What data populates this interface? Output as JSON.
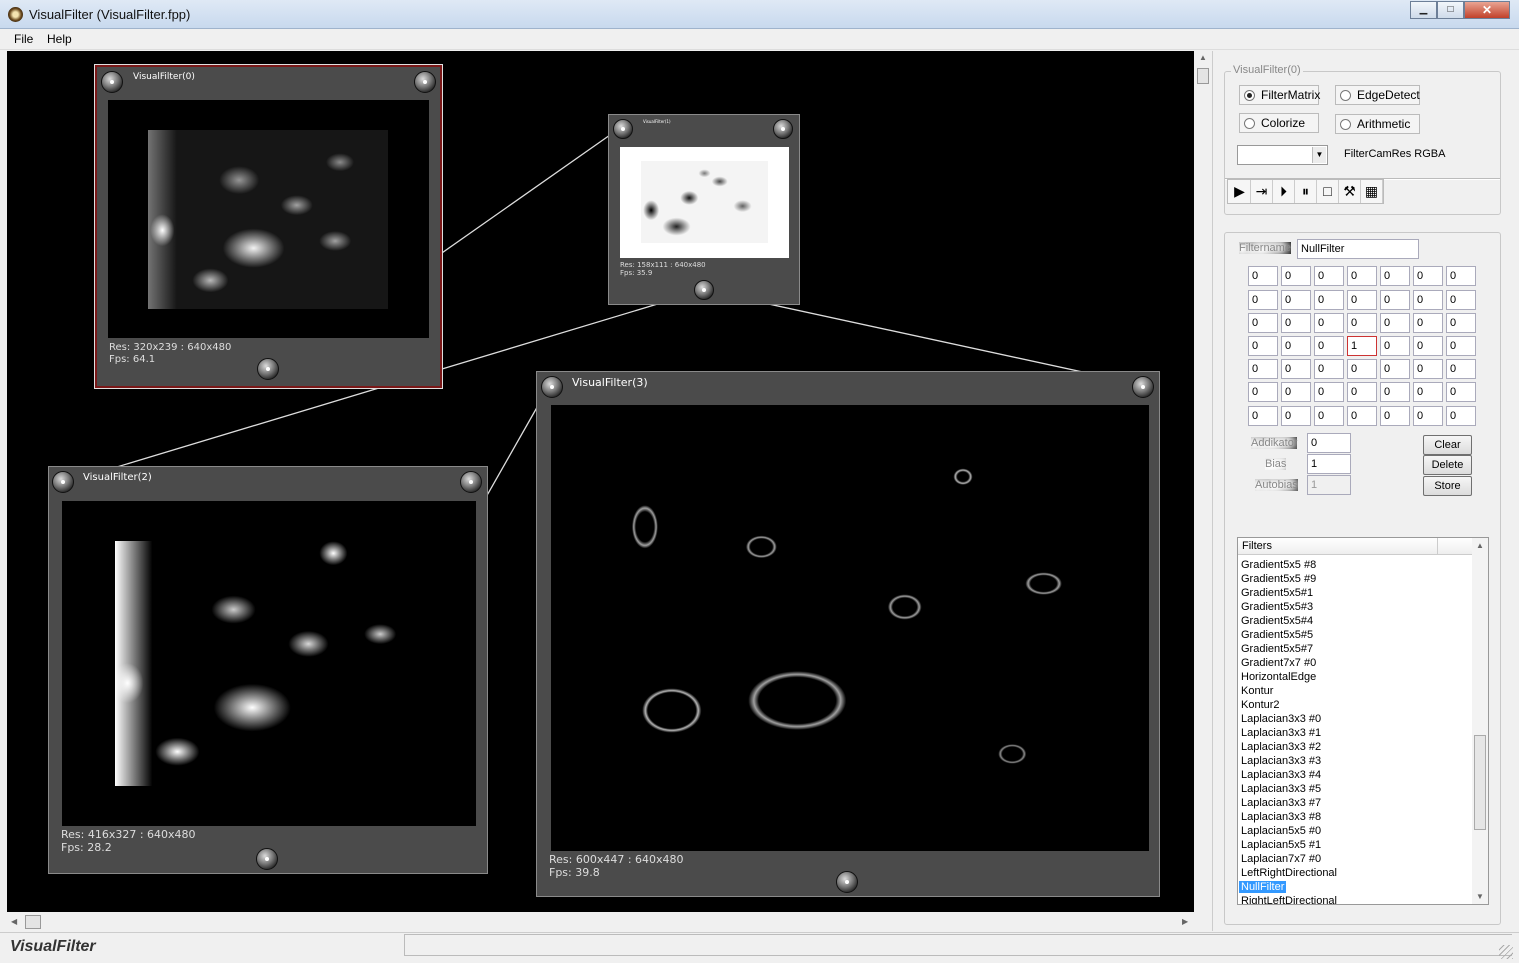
{
  "window": {
    "title": "VisualFilter  (VisualFilter.fpp)",
    "minimize_glyph": "▁",
    "maximize_glyph": "□",
    "close_glyph": "✕"
  },
  "menu": [
    "File",
    "Help"
  ],
  "nodes": [
    {
      "title": "VisualFilter(0)",
      "res": "Res: 320x239 : 640x480",
      "fps": "Fps: 64.1"
    },
    {
      "title": "VisualFilter(1)",
      "res": "Res: 158x111 : 640x480",
      "fps": "Fps: 35.9"
    },
    {
      "title": "VisualFilter(2)",
      "res": "Res: 416x327 : 640x480",
      "fps": "Fps: 28.2"
    },
    {
      "title": "VisualFilter(3)",
      "res": "Res: 600x447 : 640x480",
      "fps": "Fps: 39.8"
    }
  ],
  "panel": {
    "group_title": "VisualFilter(0)",
    "radios": [
      {
        "label": "FilterMatrix",
        "selected": true
      },
      {
        "label": "EdgeDetect",
        "selected": false
      },
      {
        "label": "Colorize",
        "selected": false
      },
      {
        "label": "Arithmetic",
        "selected": false
      }
    ],
    "combo_value": "",
    "combo_label": "FilterCamRes RGBA",
    "toolbar": [
      {
        "name": "play-icon",
        "glyph": "▶"
      },
      {
        "name": "step-forward-icon",
        "glyph": "⇥"
      },
      {
        "name": "next-frame-icon",
        "glyph": "⏵"
      },
      {
        "name": "pause-icon",
        "glyph": "⏸"
      },
      {
        "name": "stop-icon",
        "glyph": "□"
      },
      {
        "name": "tool-icon",
        "glyph": "⚒"
      },
      {
        "name": "film-icon",
        "glyph": "▦"
      }
    ],
    "filtername_label": "Filtername",
    "filtername_value": "NullFilter",
    "matrix": [
      [
        "0",
        "0",
        "0",
        "0",
        "0",
        "0",
        "0"
      ],
      [
        "0",
        "0",
        "0",
        "0",
        "0",
        "0",
        "0"
      ],
      [
        "0",
        "0",
        "0",
        "0",
        "0",
        "0",
        "0"
      ],
      [
        "0",
        "0",
        "0",
        "1",
        "0",
        "0",
        "0"
      ],
      [
        "0",
        "0",
        "0",
        "0",
        "0",
        "0",
        "0"
      ],
      [
        "0",
        "0",
        "0",
        "0",
        "0",
        "0",
        "0"
      ],
      [
        "0",
        "0",
        "0",
        "0",
        "0",
        "0",
        "0"
      ]
    ],
    "addikator_label": "Addikator",
    "addikator_value": "0",
    "bias_label": "Bias",
    "bias_value": "1",
    "autobias_label": "Autobias",
    "autobias_value": "1",
    "buttons": {
      "clear": "Clear",
      "delete": "Delete",
      "store": "Store"
    },
    "filters_header": "Filters",
    "filters": [
      "Gradient5x5 #8",
      "Gradient5x5 #9",
      "Gradient5x5#1",
      "Gradient5x5#3",
      "Gradient5x5#4",
      "Gradient5x5#5",
      "Gradient5x5#7",
      "Gradient7x7 #0",
      "HorizontalEdge",
      "Kontur",
      "Kontur2",
      "Laplacian3x3 #0",
      "Laplacian3x3 #1",
      "Laplacian3x3 #2",
      "Laplacian3x3 #3",
      "Laplacian3x3 #4",
      "Laplacian3x3 #5",
      "Laplacian3x3 #7",
      "Laplacian3x3 #8",
      "Laplacian5x5 #0",
      "Laplacian5x5 #1",
      "Laplacian7x7 #0",
      "LeftRightDirectional",
      "NullFilter",
      "RightLeftDirectional"
    ],
    "selected_filter": "NullFilter"
  },
  "status": {
    "label": "VisualFilter",
    "text": ""
  },
  "colors": {
    "accent": "#3399ff",
    "node_bg": "#4b4b4b",
    "selected_border": "#7a1818",
    "canvas": "#000000"
  }
}
